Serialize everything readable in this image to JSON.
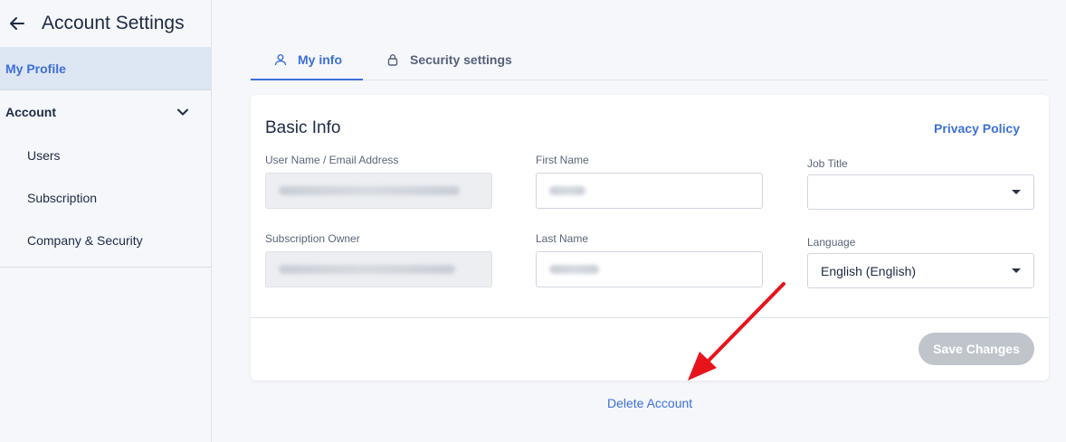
{
  "sidebar": {
    "title": "Account Settings",
    "my_profile": "My Profile",
    "account": "Account",
    "items": [
      "Users",
      "Subscription",
      "Company & Security"
    ]
  },
  "tabs": [
    {
      "label": "My info",
      "icon": "user-icon",
      "active": true
    },
    {
      "label": "Security settings",
      "icon": "lock-icon",
      "active": false
    }
  ],
  "basic_info": {
    "title": "Basic Info",
    "privacy_link": "Privacy Policy",
    "fields": {
      "username_label": "User Name / Email Address",
      "first_name_label": "First Name",
      "job_title_label": "Job Title",
      "subscription_owner_label": "Subscription Owner",
      "last_name_label": "Last Name",
      "language_label": "Language",
      "language_value": "English (English)",
      "job_title_value": ""
    },
    "save_label": "Save Changes"
  },
  "delete_account": "Delete Account",
  "colors": {
    "accent": "#3d6fd8",
    "disabled_button": "#c0c5cc",
    "annotation_arrow": "#e8141b"
  }
}
